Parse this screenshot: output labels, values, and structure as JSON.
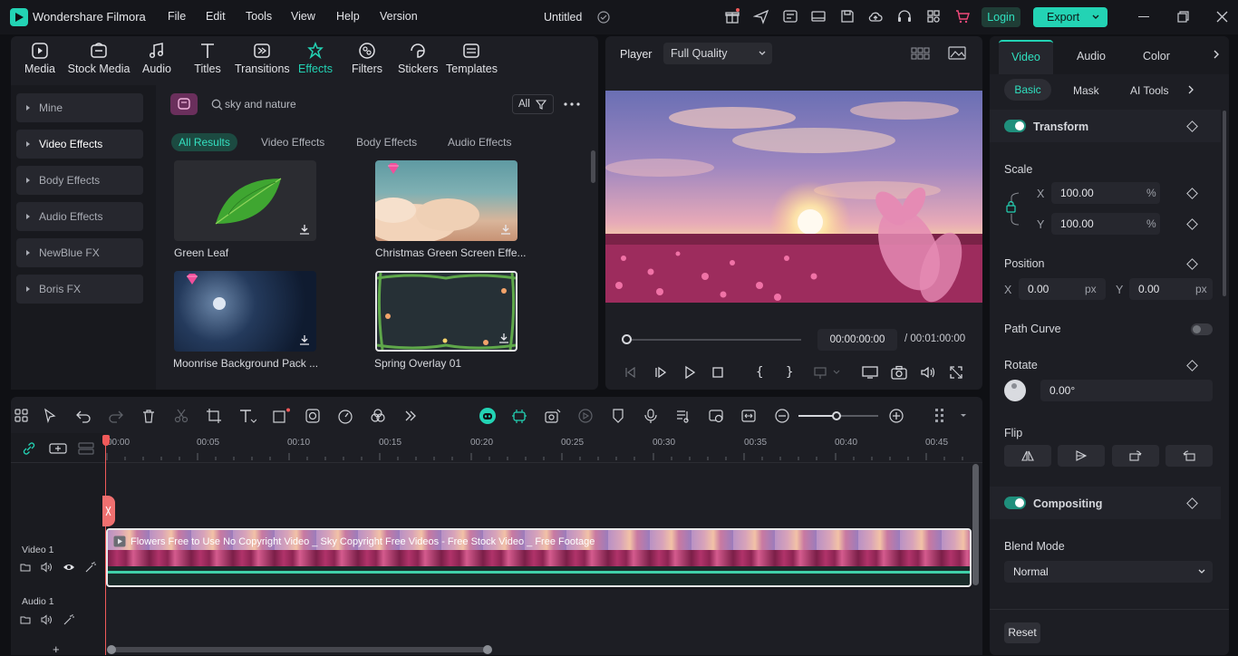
{
  "app": {
    "name": "Wondershare Filmora",
    "project_title": "Untitled"
  },
  "menu": [
    "File",
    "Edit",
    "Tools",
    "View",
    "Help",
    "Version"
  ],
  "header": {
    "login_label": "Login",
    "export_label": "Export"
  },
  "toolbar_tabs": [
    {
      "label": "Media",
      "icon": "media-icon"
    },
    {
      "label": "Stock Media",
      "icon": "stock-media-icon"
    },
    {
      "label": "Audio",
      "icon": "audio-icon"
    },
    {
      "label": "Titles",
      "icon": "titles-icon"
    },
    {
      "label": "Transitions",
      "icon": "transitions-icon"
    },
    {
      "label": "Effects",
      "icon": "effects-icon",
      "active": true
    },
    {
      "label": "Filters",
      "icon": "filters-icon"
    },
    {
      "label": "Stickers",
      "icon": "stickers-icon"
    },
    {
      "label": "Templates",
      "icon": "templates-icon"
    }
  ],
  "sidebar": {
    "items": [
      "Mine",
      "Video Effects",
      "Body Effects",
      "Audio Effects",
      "NewBlue FX",
      "Boris FX"
    ]
  },
  "search": {
    "value": "sky and nature",
    "filter_label": "All"
  },
  "result_tabs": [
    "All Results",
    "Video Effects",
    "Body Effects",
    "Audio Effects"
  ],
  "effects": [
    {
      "label": "Green Leaf",
      "premium": false
    },
    {
      "label": "Christmas Green Screen Effe...",
      "premium": true
    },
    {
      "label": "Moonrise Background Pack ...",
      "premium": true
    },
    {
      "label": "Spring Overlay 01",
      "premium": false
    }
  ],
  "player": {
    "label": "Player",
    "quality": "Full Quality",
    "current_time": "00:00:00:00",
    "total_time": "/ 00:01:00:00"
  },
  "properties": {
    "tabs": [
      "Video",
      "Audio",
      "Color"
    ],
    "subtabs": [
      "Basic",
      "Mask",
      "AI Tools"
    ],
    "transform_label": "Transform",
    "scale_label": "Scale",
    "scale_x": "100.00",
    "scale_y": "100.00",
    "percent": "%",
    "x_label": "X",
    "y_label": "Y",
    "position_label": "Position",
    "position_x": "0.00",
    "position_y": "0.00",
    "px": "px",
    "path_curve_label": "Path Curve",
    "rotate_label": "Rotate",
    "rotate_value": "0.00°",
    "flip_label": "Flip",
    "compositing_label": "Compositing",
    "blend_mode_label": "Blend Mode",
    "blend_mode_value": "Normal",
    "reset_label": "Reset"
  },
  "timeline": {
    "ruler": [
      "00:00",
      "00:05",
      "00:10",
      "00:15",
      "00:20",
      "00:25",
      "00:30",
      "00:35",
      "00:40",
      "00:45"
    ],
    "video_track_label": "Video 1",
    "audio_track_label": "Audio 1",
    "clip_title": "Flowers Free to Use No Copyright Video _ Sky Copyright Free Videos - Free Stock Video _ Free Footage"
  },
  "colors": {
    "accent": "#23d3b4",
    "background": "#0f1014",
    "panel": "#1d1e24",
    "playhead": "#f05a5a",
    "login_bg": "#1f3d36",
    "export_bg": "#23d3b4"
  }
}
